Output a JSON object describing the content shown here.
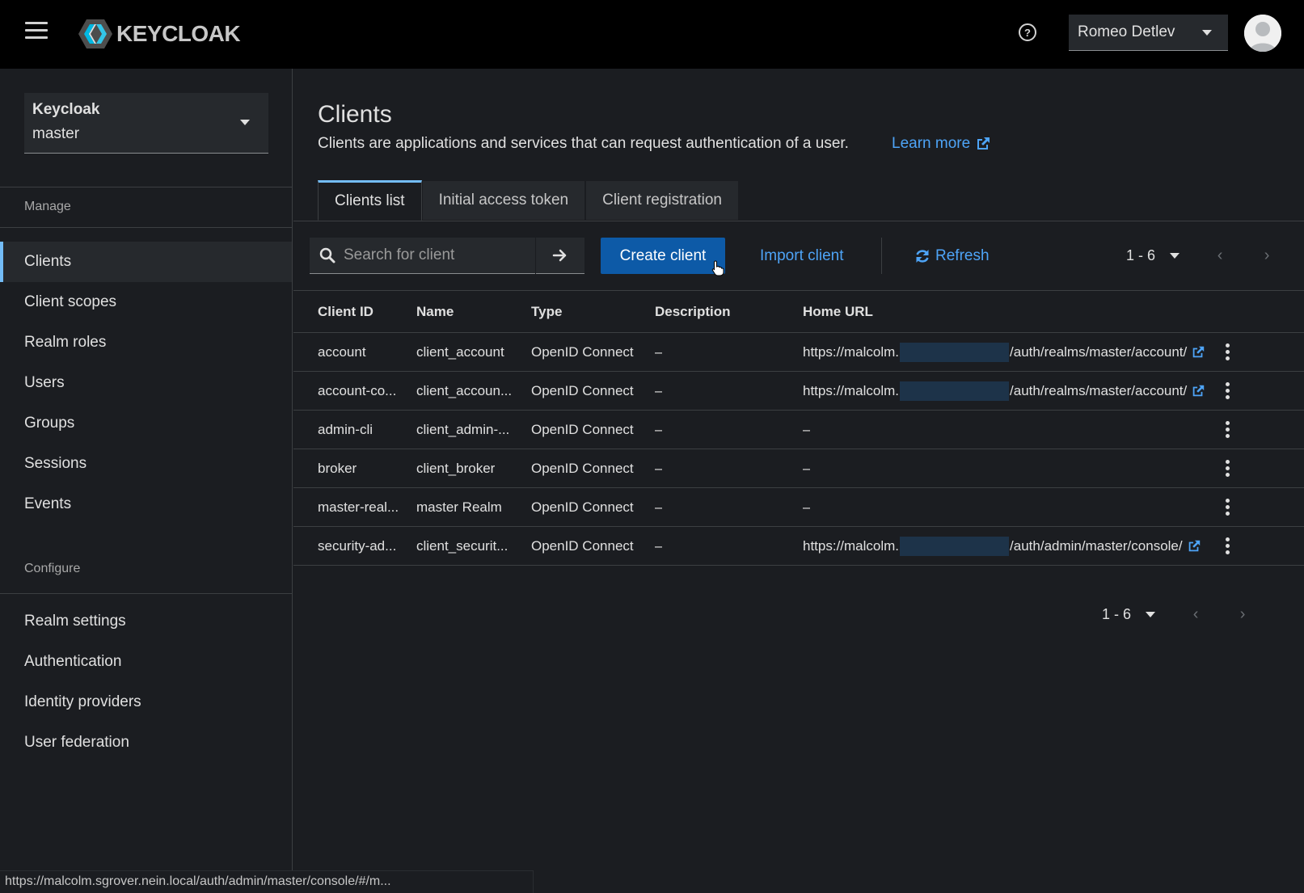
{
  "app": {
    "logo_text": "KEYCLOAK"
  },
  "header": {
    "user_name": "Romeo Detlev"
  },
  "sidebar": {
    "realm": {
      "name": "Keycloak",
      "value": "master"
    },
    "manage_heading": "Manage",
    "manage_items": [
      {
        "label": "Clients",
        "active": true
      },
      {
        "label": "Client scopes"
      },
      {
        "label": "Realm roles"
      },
      {
        "label": "Users"
      },
      {
        "label": "Groups"
      },
      {
        "label": "Sessions"
      },
      {
        "label": "Events"
      }
    ],
    "configure_heading": "Configure",
    "configure_items": [
      {
        "label": "Realm settings"
      },
      {
        "label": "Authentication"
      },
      {
        "label": "Identity providers"
      },
      {
        "label": "User federation"
      }
    ]
  },
  "page": {
    "title": "Clients",
    "description": "Clients are applications and services that can request authentication of a user.",
    "learn_more": "Learn more"
  },
  "tabs": [
    {
      "label": "Clients list",
      "active": true
    },
    {
      "label": "Initial access token"
    },
    {
      "label": "Client registration"
    }
  ],
  "toolbar": {
    "search_placeholder": "Search for client",
    "create_label": "Create client",
    "import_label": "Import client",
    "refresh_label": "Refresh",
    "pagination": "1 - 6"
  },
  "table": {
    "headers": [
      "Client ID",
      "Name",
      "Type",
      "Description",
      "Home URL"
    ],
    "rows": [
      {
        "client_id": "account",
        "name": "client_account",
        "type": "OpenID Connect",
        "description": "–",
        "url_prefix": "https://malcolm.",
        "url_suffix": "/auth/realms/master/account/",
        "has_url": true
      },
      {
        "client_id": "account-co...",
        "name": "client_accoun...",
        "type": "OpenID Connect",
        "description": "–",
        "url_prefix": "https://malcolm.",
        "url_suffix": "/auth/realms/master/account/",
        "has_url": true
      },
      {
        "client_id": "admin-cli",
        "name": "client_admin-...",
        "type": "OpenID Connect",
        "description": "–",
        "url_text": "–",
        "has_url": false
      },
      {
        "client_id": "broker",
        "name": "client_broker",
        "type": "OpenID Connect",
        "description": "–",
        "url_text": "–",
        "has_url": false
      },
      {
        "client_id": "master-real...",
        "name": "master Realm",
        "type": "OpenID Connect",
        "description": "–",
        "url_text": "–",
        "has_url": false
      },
      {
        "client_id": "security-ad...",
        "name": "client_securit...",
        "type": "OpenID Connect",
        "description": "–",
        "url_prefix": "https://malcolm.",
        "url_suffix": "/auth/admin/master/console/",
        "has_url": true
      }
    ]
  },
  "footer_pagination": "1 - 6",
  "status_bar": "https://malcolm.sgrover.nein.local/auth/admin/master/console/#/m...",
  "colors": {
    "accent": "#73bcf7",
    "link": "#4ea4f7",
    "primary_button": "#0d5aa7",
    "masthead": "#000000",
    "background": "#1b1d21"
  }
}
